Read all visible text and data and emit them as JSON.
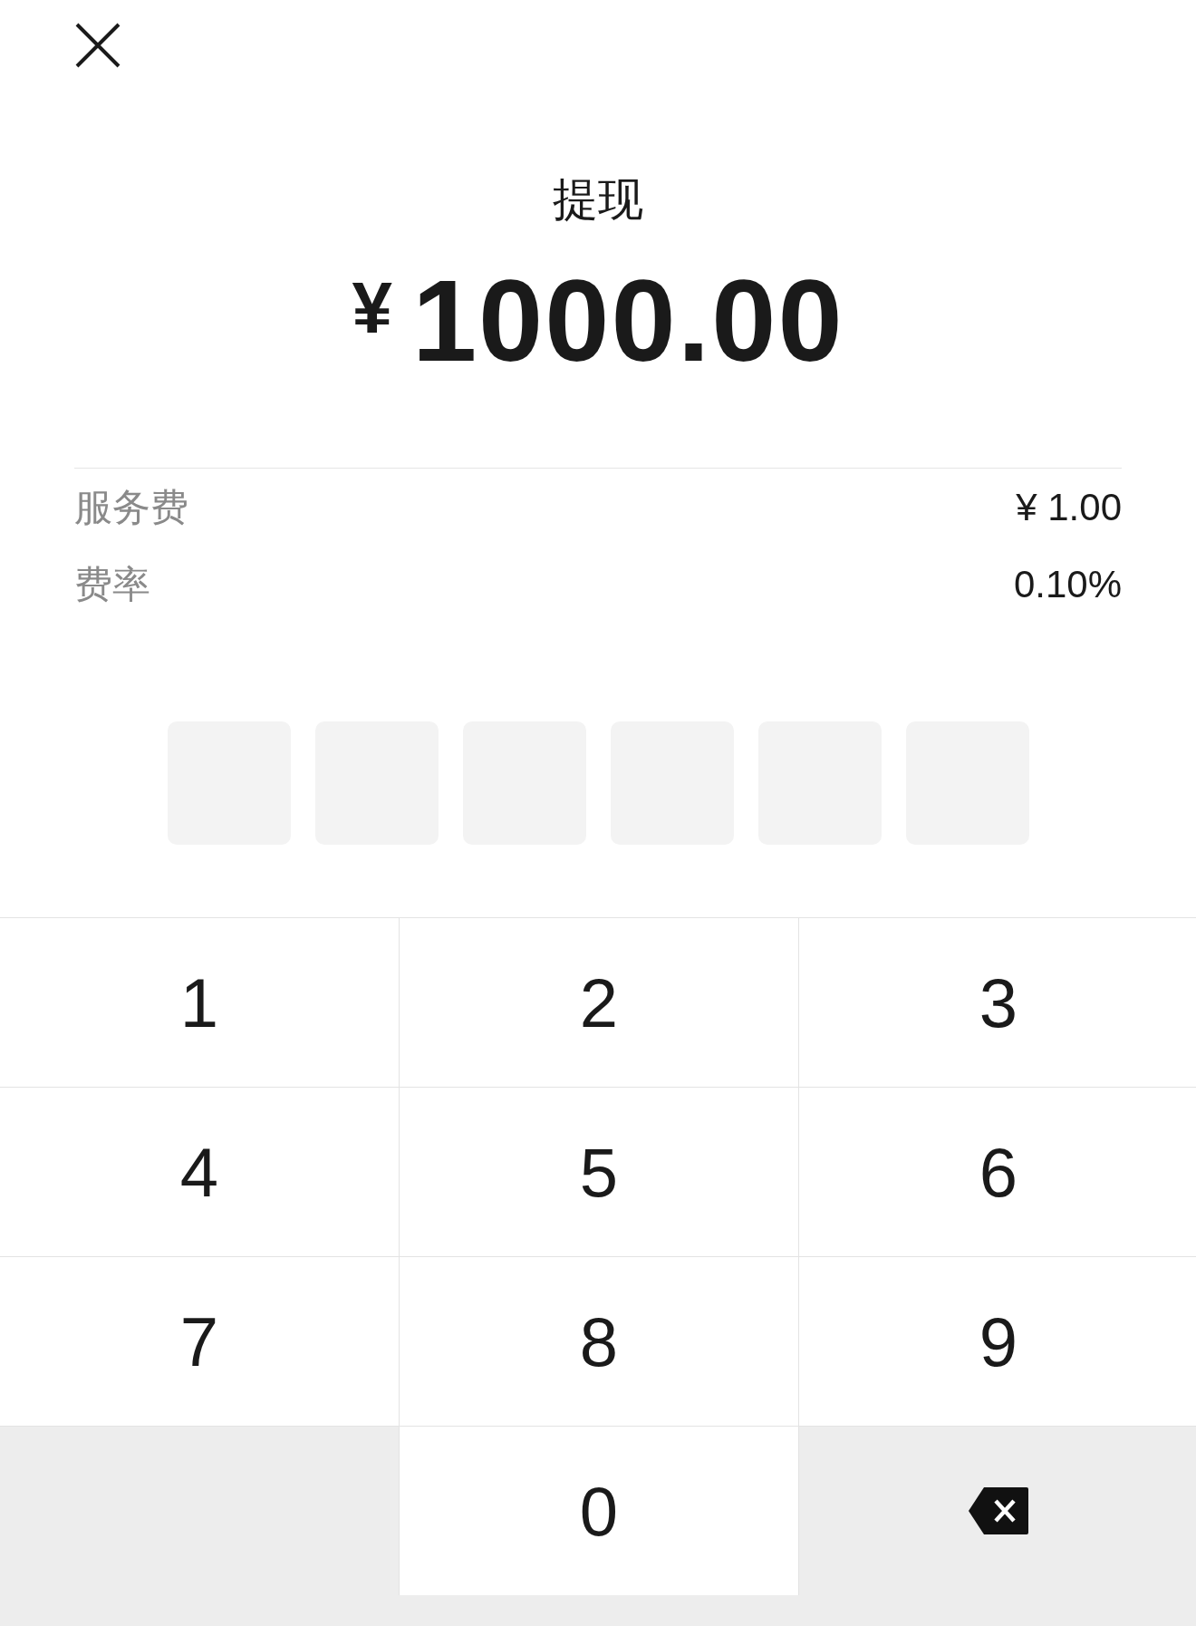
{
  "title": "提现",
  "amount": {
    "currency": "¥",
    "value": "1000.00"
  },
  "details": [
    {
      "label": "服务费",
      "value": "¥ 1.00"
    },
    {
      "label": "费率",
      "value": "0.10%"
    }
  ],
  "pin_boxes": [
    {
      "filled": false
    },
    {
      "filled": false
    },
    {
      "filled": false
    },
    {
      "filled": false
    },
    {
      "filled": false
    },
    {
      "filled": false
    }
  ],
  "keypad": [
    {
      "kind": "digit",
      "label": "1"
    },
    {
      "kind": "digit",
      "label": "2"
    },
    {
      "kind": "digit",
      "label": "3"
    },
    {
      "kind": "digit",
      "label": "4"
    },
    {
      "kind": "digit",
      "label": "5"
    },
    {
      "kind": "digit",
      "label": "6"
    },
    {
      "kind": "digit",
      "label": "7"
    },
    {
      "kind": "digit",
      "label": "8"
    },
    {
      "kind": "digit",
      "label": "9"
    },
    {
      "kind": "empty"
    },
    {
      "kind": "digit",
      "label": "0"
    },
    {
      "kind": "backspace"
    }
  ]
}
